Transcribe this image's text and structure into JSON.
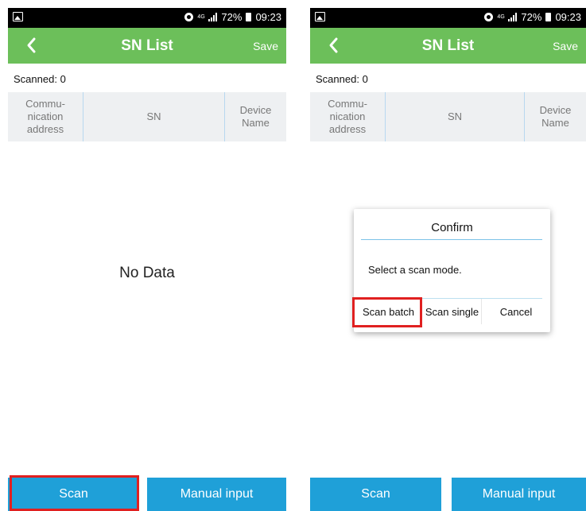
{
  "status_bar": {
    "network": "4G",
    "battery": "72%",
    "time": "09:23",
    "icons": [
      "picture-icon",
      "alarm-icon",
      "signal-icon",
      "battery-icon"
    ]
  },
  "header": {
    "title": "SN List",
    "save_label": "Save",
    "back_icon": "chevron-left-icon"
  },
  "scanned": {
    "label": "Scanned:",
    "count": "0"
  },
  "table": {
    "columns": [
      "Commu-\nnication\naddress",
      "SN",
      "Device\nName"
    ]
  },
  "empty_text": "No Data",
  "bottom": {
    "scan_label": "Scan",
    "manual_label": "Manual input"
  },
  "dialog": {
    "title": "Confirm",
    "message": "Select a scan mode.",
    "buttons": [
      "Scan batch",
      "Scan single",
      "Cancel"
    ]
  },
  "colors": {
    "appbar": "#6cbf5a",
    "button": "#1fa0d8",
    "highlight": "#e02020",
    "divider": "#7cc3e8"
  }
}
